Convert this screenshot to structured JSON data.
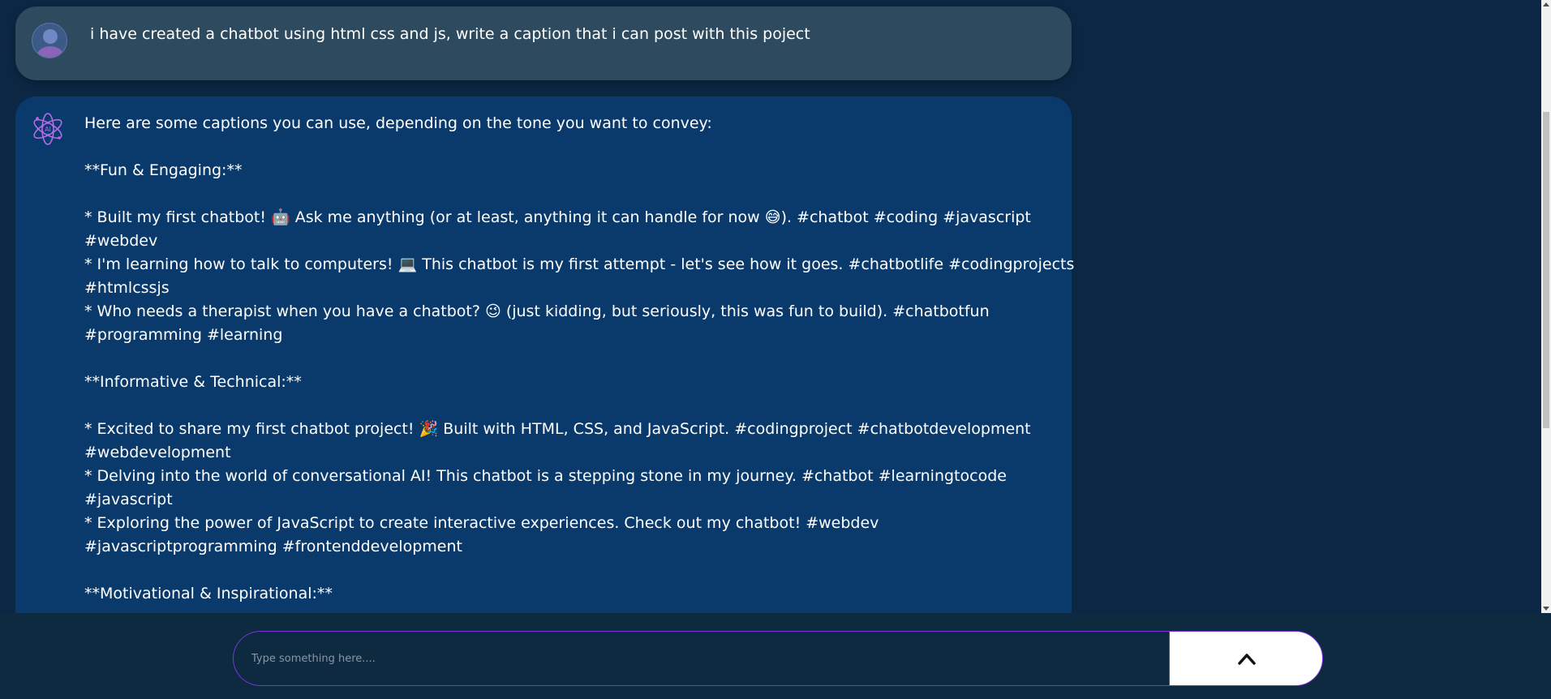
{
  "user_message": {
    "text": "i have created a chatbot using html css and js, write a caption that i can post with this poject"
  },
  "ai_message": {
    "lines": [
      "Here are some captions you can use, depending on the tone you want to convey:",
      "",
      "**Fun & Engaging:**",
      "",
      "* Built my first chatbot! 🤖 Ask me anything (or at least, anything it can handle for now 😅). #chatbot #coding #javascript",
      "#webdev",
      "* I'm learning how to talk to computers! 💻 This chatbot is my first attempt - let's see how it goes. #chatbotlife #codingprojects",
      "#htmlcssjs",
      "* Who needs a therapist when you have a chatbot? 😉 (just kidding, but seriously, this was fun to build). #chatbotfun",
      "#programming #learning",
      "",
      "**Informative & Technical:**",
      "",
      "* Excited to share my first chatbot project! 🎉 Built with HTML, CSS, and JavaScript. #codingproject #chatbotdevelopment",
      "#webdevelopment",
      "* Delving into the world of conversational AI! This chatbot is a stepping stone in my journey. #chatbot #learningtocode",
      "#javascript",
      "* Exploring the power of JavaScript to create interactive experiences. Check out my chatbot! #webdev",
      "#javascriptprogramming #frontenddevelopment",
      "",
      "**Motivational & Inspirational:**"
    ]
  },
  "input": {
    "placeholder": "Type something here....",
    "value": ""
  },
  "icons": {
    "user_avatar": "user-avatar-icon",
    "ai_avatar": "ai-atom-icon",
    "send": "chevron-up-icon"
  },
  "colors": {
    "background": "#0c2744",
    "user_bubble": "#2d4a5e",
    "ai_bubble": "#0a3a6c",
    "accent": "#7a35e0"
  }
}
